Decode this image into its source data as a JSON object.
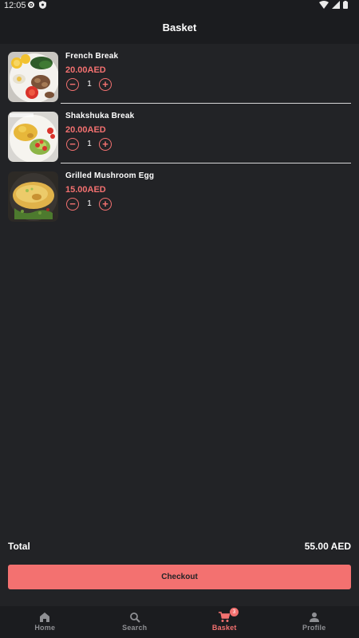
{
  "status_bar": {
    "time": "12:05"
  },
  "header": {
    "title": "Basket"
  },
  "basket": {
    "items": [
      {
        "name": "French Break",
        "price": "20.00AED",
        "quantity": "1",
        "minus": "−",
        "plus": "+"
      },
      {
        "name": "Shakshuka Break",
        "price": "20.00AED",
        "quantity": "1",
        "minus": "−",
        "plus": "+"
      },
      {
        "name": "Grilled Mushroom Egg",
        "price": "15.00AED",
        "quantity": "1",
        "minus": "−",
        "plus": "+"
      }
    ]
  },
  "summary": {
    "total_label": "Total",
    "total_value": "55.00 AED"
  },
  "checkout": {
    "label": "Checkout"
  },
  "nav": {
    "items": [
      {
        "label": "Home",
        "icon": "home-icon"
      },
      {
        "label": "Search",
        "icon": "search-icon"
      },
      {
        "label": "Basket",
        "icon": "cart-icon",
        "badge": "3"
      },
      {
        "label": "Profile",
        "icon": "person-icon"
      }
    ],
    "active": "Basket"
  },
  "colors": {
    "accent": "#f37170",
    "background": "#222326",
    "bar": "#1b1c1f",
    "inactive": "#8e8f93"
  }
}
